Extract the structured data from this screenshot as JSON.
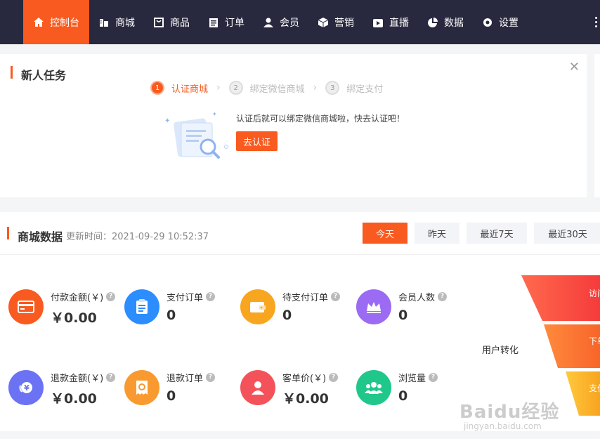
{
  "nav": {
    "items": [
      {
        "label": "控制台",
        "icon": "home-icon"
      },
      {
        "label": "商城",
        "icon": "store-icon"
      },
      {
        "label": "商品",
        "icon": "bag-icon"
      },
      {
        "label": "订单",
        "icon": "clipboard-icon"
      },
      {
        "label": "会员",
        "icon": "user-icon"
      },
      {
        "label": "营销",
        "icon": "box-icon"
      },
      {
        "label": "直播",
        "icon": "live-icon"
      },
      {
        "label": "数据",
        "icon": "pie-icon"
      },
      {
        "label": "设置",
        "icon": "gear-icon"
      }
    ],
    "active_color": "#f85a1f",
    "bg_color": "#28283f"
  },
  "task": {
    "title": "新人任务",
    "steps": [
      {
        "num": "1",
        "label": "认证商城",
        "active": true
      },
      {
        "num": "2",
        "label": "绑定微信商城",
        "active": false
      },
      {
        "num": "3",
        "label": "绑定支付",
        "active": false
      }
    ],
    "description": "认证后就可以绑定微信商城啦，快去认证吧！",
    "button_label": "去认证"
  },
  "mall_data": {
    "title": "商城数据",
    "update_time": "更新时间：2021-09-29 10:52:37",
    "ranges": [
      "今天",
      "昨天",
      "最近7天",
      "最近30天"
    ],
    "active_range": "今天",
    "stats": [
      {
        "label": "付款金额(￥)",
        "value": "￥0.00",
        "icon": "card-icon",
        "color": "#f85a1f"
      },
      {
        "label": "支付订单",
        "value": "0",
        "icon": "order-icon",
        "color": "#2c8dff"
      },
      {
        "label": "待支付订单",
        "value": "0",
        "icon": "wallet-icon",
        "color": "#f8a61f"
      },
      {
        "label": "会员人数",
        "value": "0",
        "icon": "crown-icon",
        "color": "#9b6bf4"
      },
      {
        "label": "退款金额(￥)",
        "value": "￥0.00",
        "icon": "refund-icon",
        "color": "#6b73f4"
      },
      {
        "label": "退款订单",
        "value": "0",
        "icon": "refund-order-icon",
        "color": "#f89a2f"
      },
      {
        "label": "客单价(￥)",
        "value": "￥0.00",
        "icon": "person-icon",
        "color": "#f4525a"
      },
      {
        "label": "浏览量",
        "value": "0",
        "icon": "group-icon",
        "color": "#1fc88a"
      }
    ],
    "funnel_label": "用户转化",
    "funnel_stages": [
      "访问",
      "下单",
      "支付"
    ]
  },
  "watermark": {
    "text": "Baidu经验",
    "sub": "jingyan.baidu.com"
  }
}
